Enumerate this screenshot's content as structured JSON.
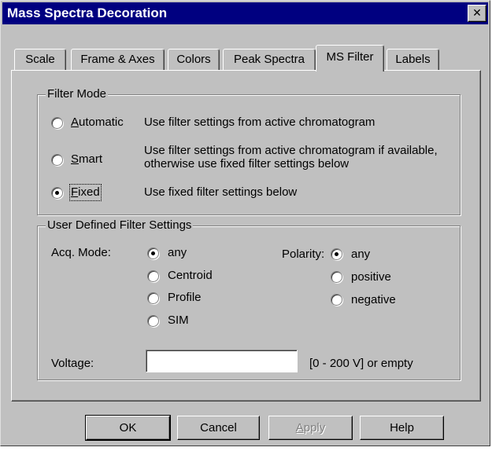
{
  "window": {
    "title": "Mass Spectra Decoration",
    "close_glyph": "✕"
  },
  "tabs": [
    {
      "label": "Scale"
    },
    {
      "label": "Frame & Axes"
    },
    {
      "label": "Colors"
    },
    {
      "label": "Peak Spectra"
    },
    {
      "label": "MS Filter",
      "active": true
    },
    {
      "label": "Labels"
    }
  ],
  "filter_mode": {
    "group_label": "Filter Mode",
    "options": [
      {
        "mnemonic": "A",
        "rest": "utomatic",
        "label": "Automatic",
        "description": "Use filter settings from active chromatogram",
        "selected": false
      },
      {
        "mnemonic": "S",
        "rest": "mart",
        "label": "Smart",
        "description": "Use filter settings from active chromatogram if available, otherwise use fixed filter settings below",
        "selected": false
      },
      {
        "mnemonic": "F",
        "rest": "ixed",
        "label": "Fixed",
        "description": "Use fixed filter settings below",
        "selected": true
      }
    ]
  },
  "user_defined": {
    "group_label": "User Defined Filter Settings",
    "acq_mode": {
      "label": "Acq. Mode:",
      "options": [
        {
          "label": "any",
          "selected": true
        },
        {
          "label": "Centroid",
          "selected": false
        },
        {
          "label": "Profile",
          "selected": false
        },
        {
          "label": "SIM",
          "selected": false
        }
      ]
    },
    "polarity": {
      "label": "Polarity:",
      "options": [
        {
          "label": "any",
          "selected": true
        },
        {
          "label": "positive",
          "selected": false
        },
        {
          "label": "negative",
          "selected": false
        }
      ]
    },
    "voltage": {
      "label": "Voltage:",
      "value": "",
      "hint": "[0 - 200 V] or empty"
    }
  },
  "buttons": {
    "ok": "OK",
    "cancel": "Cancel",
    "apply_mnemonic": "A",
    "apply_rest": "pply",
    "help": "Help"
  },
  "colors": {
    "titlebar": "#000080",
    "face": "#c0c0c0"
  }
}
